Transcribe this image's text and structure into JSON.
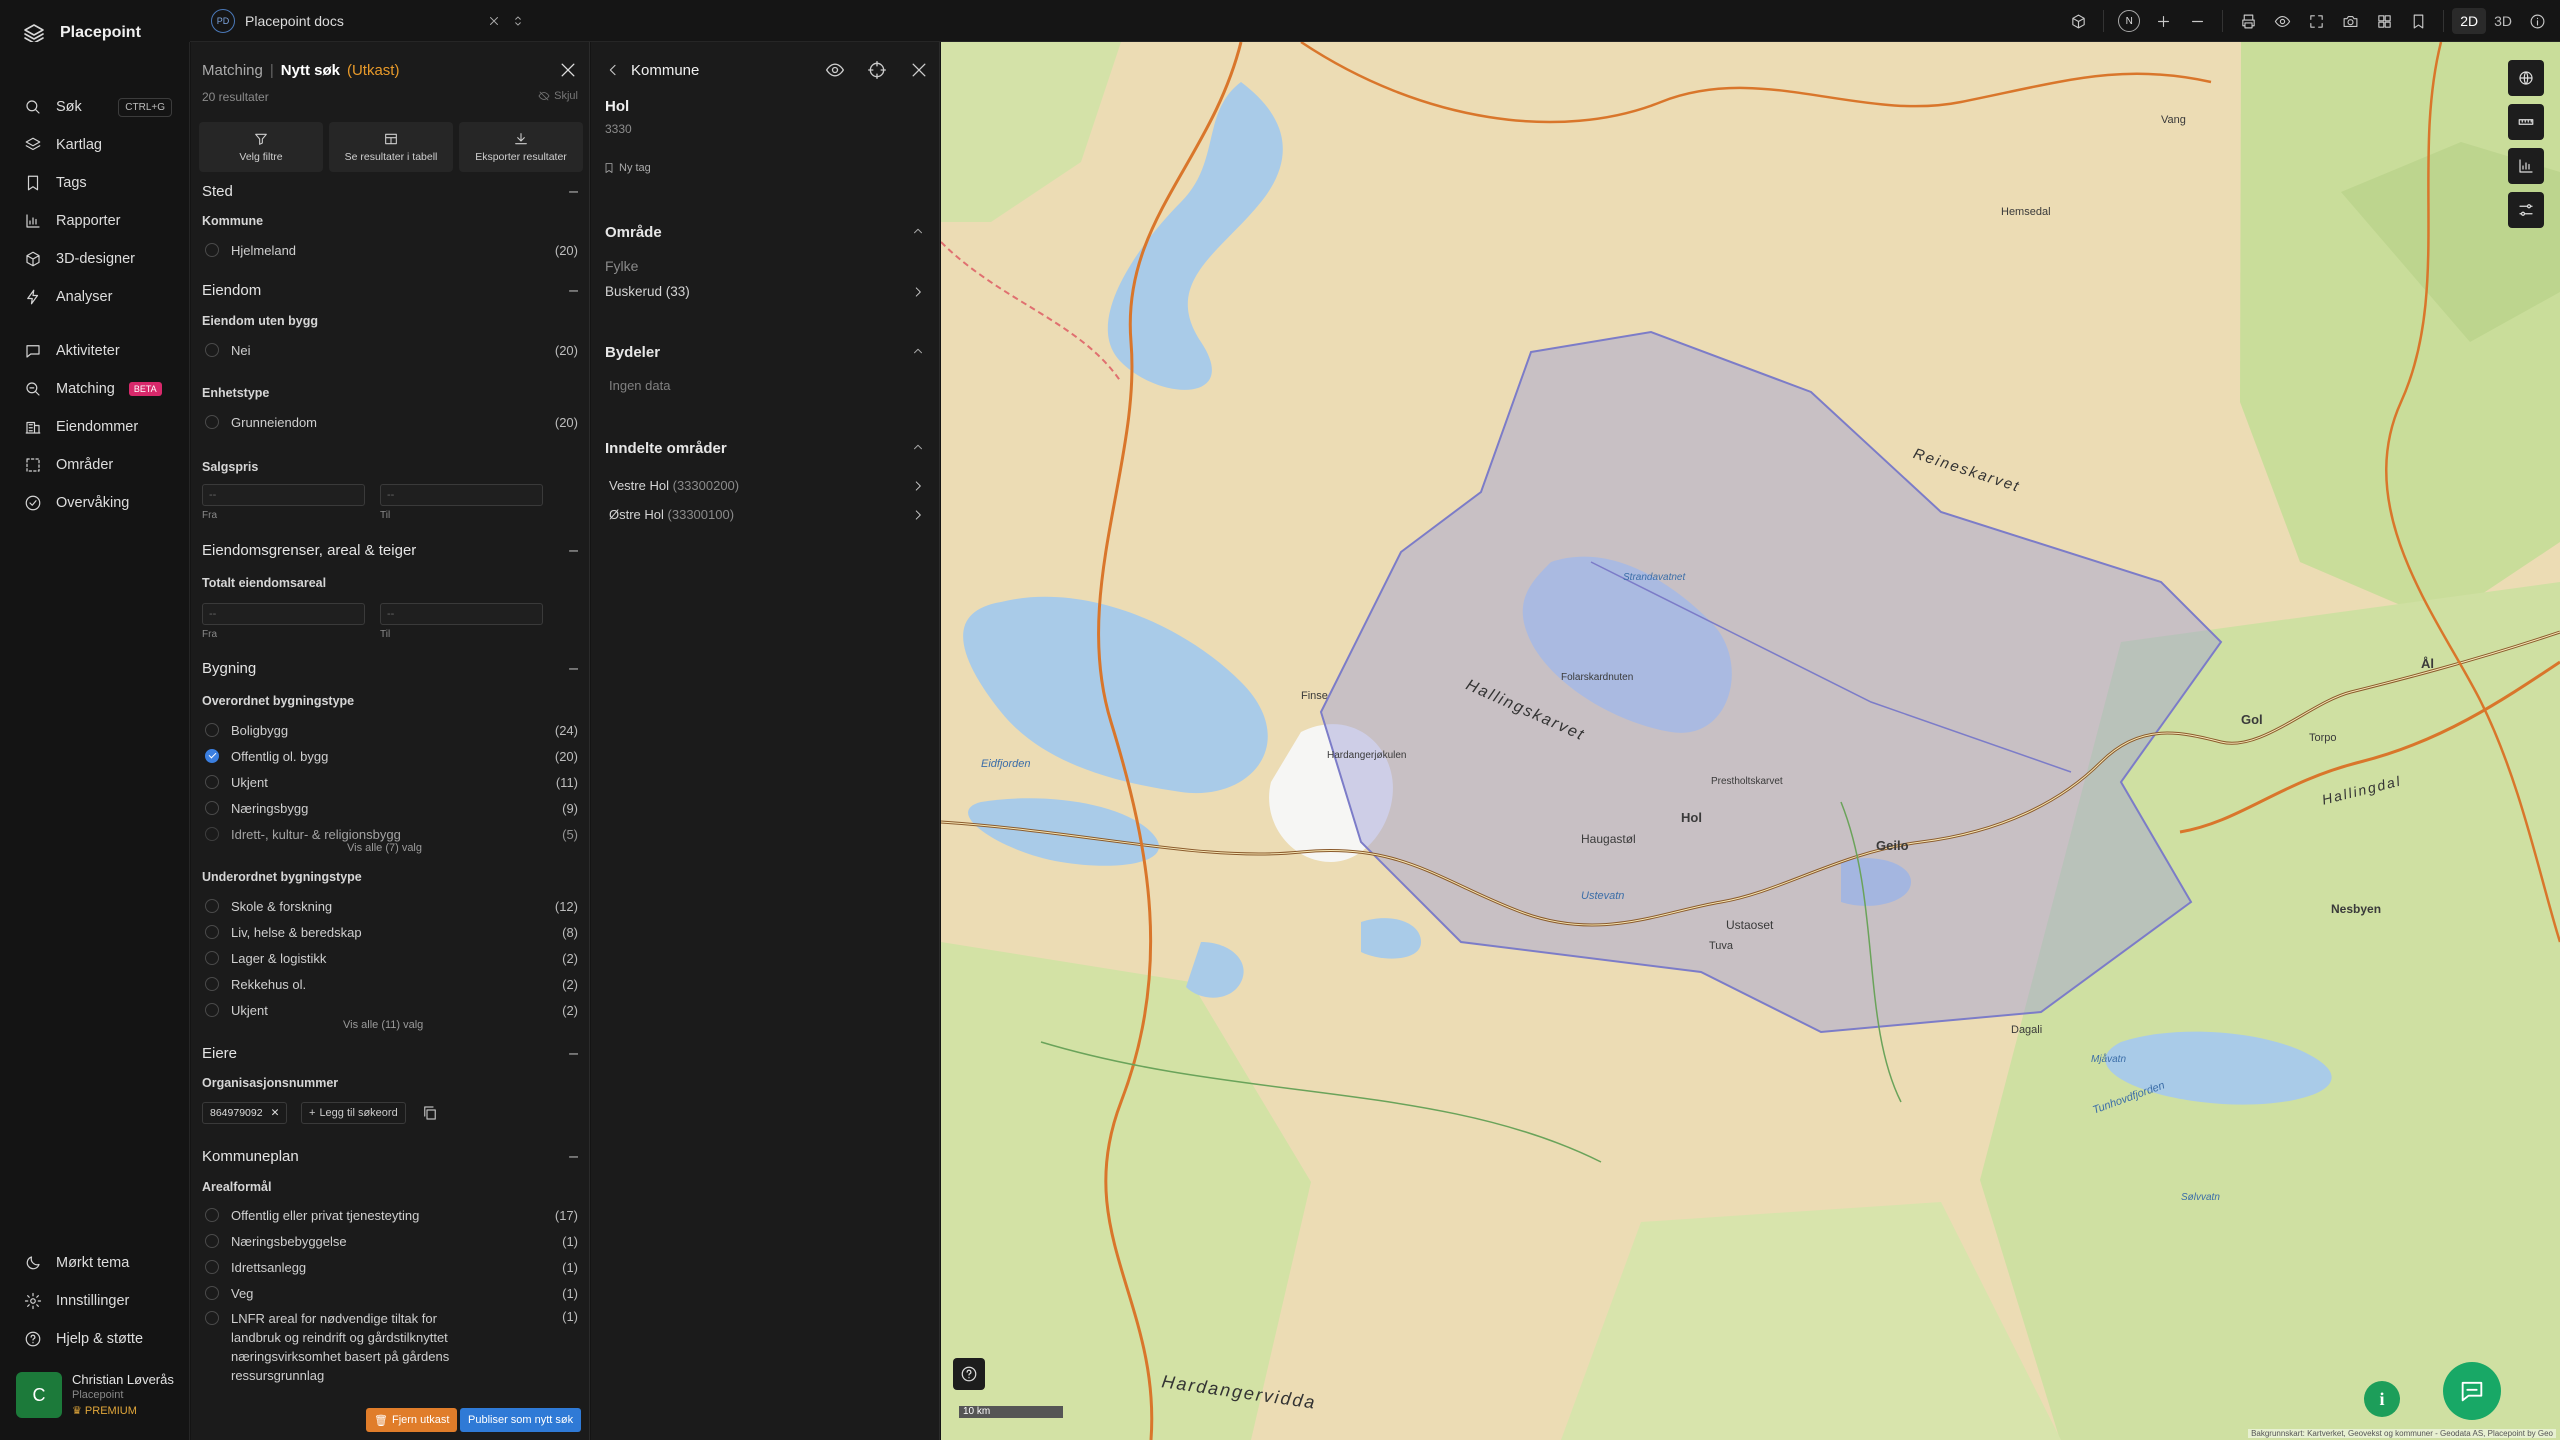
{
  "app": {
    "name": "Placepoint"
  },
  "document_tab": {
    "badge": "PD",
    "title": "Placepoint docs"
  },
  "toolbar": {
    "compass": "N",
    "mode_2d": "2D",
    "mode_3d": "3D"
  },
  "sidebar": {
    "search": {
      "label": "Søk",
      "shortcut": "CTRL+G"
    },
    "items": [
      {
        "label": "Kartlag"
      },
      {
        "label": "Tags"
      },
      {
        "label": "Rapporter"
      },
      {
        "label": "3D-designer"
      },
      {
        "label": "Analyser"
      },
      {
        "label": "Aktiviteter"
      },
      {
        "label": "Matching",
        "badge": "BETA"
      },
      {
        "label": "Eiendommer"
      },
      {
        "label": "Områder"
      },
      {
        "label": "Overvåking"
      }
    ],
    "bottom": [
      {
        "label": "Mørkt tema"
      },
      {
        "label": "Innstillinger"
      },
      {
        "label": "Hjelp & støtte"
      }
    ],
    "user": {
      "initial": "C",
      "name": "Christian Løverås",
      "org": "Placepoint",
      "plan": "PREMIUM"
    }
  },
  "filter_panel": {
    "breadcrumb": "Matching",
    "sep": "|",
    "title": "Nytt søk",
    "status": "(Utkast)",
    "result_count": "20 resultater",
    "hide_label": "Skjul",
    "actions": [
      "Velg filtre",
      "Se resultater i tabell",
      "Eksporter resultater"
    ],
    "sted": {
      "title": "Sted",
      "kommune_label": "Kommune",
      "options": [
        {
          "label": "Hjelmeland",
          "count": "(20)"
        }
      ]
    },
    "eiendom": {
      "title": "Eiendom",
      "uten_bygg_label": "Eiendom uten bygg",
      "uten_bygg_options": [
        {
          "label": "Nei",
          "count": "(20)"
        }
      ],
      "enhetstype_label": "Enhetstype",
      "enhetstype_options": [
        {
          "label": "Grunneiendom",
          "count": "(20)"
        }
      ],
      "salgspris_label": "Salgspris",
      "from_placeholder": "--",
      "to_placeholder": "--",
      "from": "Fra",
      "to": "Til"
    },
    "grenser": {
      "title": "Eiendomsgrenser, areal & teiger",
      "totalt_label": "Totalt eiendomsareal",
      "from_placeholder": "--",
      "to_placeholder": "--",
      "from": "Fra",
      "to": "Til"
    },
    "bygning": {
      "title": "Bygning",
      "overordnet_label": "Overordnet bygningstype",
      "overordnet_options": [
        {
          "label": "Boligbygg",
          "count": "(24)",
          "checked": false
        },
        {
          "label": "Offentlig ol. bygg",
          "count": "(20)",
          "checked": true
        },
        {
          "label": "Ukjent",
          "count": "(11)",
          "checked": false
        },
        {
          "label": "Næringsbygg",
          "count": "(9)",
          "checked": false
        },
        {
          "label": "Idrett-, kultur- & religionsbygg",
          "count": "(5)",
          "checked": false
        }
      ],
      "overordnet_show_all": "Vis alle (7) valg",
      "underordnet_label": "Underordnet bygningstype",
      "underordnet_options": [
        {
          "label": "Skole & forskning",
          "count": "(12)"
        },
        {
          "label": "Liv, helse & beredskap",
          "count": "(8)"
        },
        {
          "label": "Lager & logistikk",
          "count": "(2)"
        },
        {
          "label": "Rekkehus ol.",
          "count": "(2)"
        },
        {
          "label": "Ukjent",
          "count": "(2)"
        }
      ],
      "underordnet_show_all": "Vis alle (11) valg"
    },
    "eiere": {
      "title": "Eiere",
      "org_label": "Organisasjonsnummer",
      "chip": "864979092",
      "add_keyword": "Legg til søkeord"
    },
    "kommuneplan": {
      "title": "Kommuneplan",
      "arealformal_label": "Arealformål",
      "options": [
        {
          "label": "Offentlig eller privat tjenesteyting",
          "count": "(17)"
        },
        {
          "label": "Næringsbebyggelse",
          "count": "(1)"
        },
        {
          "label": "Idrettsanlegg",
          "count": "(1)"
        },
        {
          "label": "Veg",
          "count": "(1)"
        },
        {
          "label": "LNFR areal for nødvendige tiltak for landbruk og reindrift og gårdstilknyttet næringsvirksomhet basert på gårdens ressursgrunnlag",
          "count": "(1)"
        }
      ]
    },
    "footer": {
      "remove_draft": "Fjern utkast",
      "publish": "Publiser som nytt søk"
    }
  },
  "kommune_panel": {
    "title": "Kommune",
    "name": "Hol",
    "number": "3330",
    "new_tag": "Ny tag",
    "omrade": {
      "title": "Område",
      "fylke_label": "Fylke",
      "fylke_value": "Buskerud (33)"
    },
    "bydeler": {
      "title": "Bydeler",
      "empty": "Ingen data"
    },
    "inndelte": {
      "title": "Inndelte områder",
      "items": [
        {
          "name": "Vestre Hol",
          "code": "(33300200)"
        },
        {
          "name": "Østre Hol",
          "code": "(33300100)"
        }
      ]
    }
  },
  "map": {
    "scale": "10 km",
    "attribution": "Bakgrunnskart: Kartverket, Geovekst og kommuner - Geodata AS, Placepoint by Geo",
    "places": [
      "Hol",
      "Geilo",
      "Ustaoset",
      "Haugastøl",
      "Hallingskarvet",
      "Hardangervidda",
      "Gol",
      "Torpo",
      "Ål",
      "Hardangerjøkulen",
      "Finse",
      "Eidfjorden",
      "Dagali",
      "Tuva",
      "Prestholtskarvet",
      "Folarskardnuten",
      "Strandavatnet",
      "Reineskarvet",
      "Nesbyen",
      "Hallingdal",
      "Ustevatn",
      "Tunhovdfjorden",
      "Mjåvatn",
      "Sølvvatn",
      "Vang",
      "Hemsedal"
    ],
    "colors": {
      "terrain": "#ecdcb4",
      "forest": "#c9dd9a",
      "water": "#a9cbe8",
      "polygon": "#9e9ed8",
      "road": "#d9762b"
    }
  }
}
